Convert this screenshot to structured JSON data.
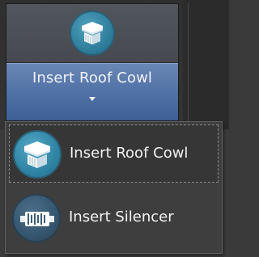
{
  "ribbon": {
    "split_button": {
      "label": "Insert Roof Cowl",
      "icon": "roof-cowl-icon",
      "dropdown_icon": "caret-down-icon"
    }
  },
  "menu": {
    "items": [
      {
        "label": "Insert Roof Cowl",
        "icon": "roof-cowl-icon",
        "focused": true
      },
      {
        "label": "Insert Silencer",
        "icon": "silencer-icon",
        "focused": false
      }
    ]
  },
  "colors": {
    "ribbon_background": "#2f2f2f",
    "split_button_blue": "#5374a8",
    "menu_background": "#3e3e3e",
    "roof_icon_teal": "#2f84a4",
    "silencer_icon_blue": "#35566f"
  }
}
